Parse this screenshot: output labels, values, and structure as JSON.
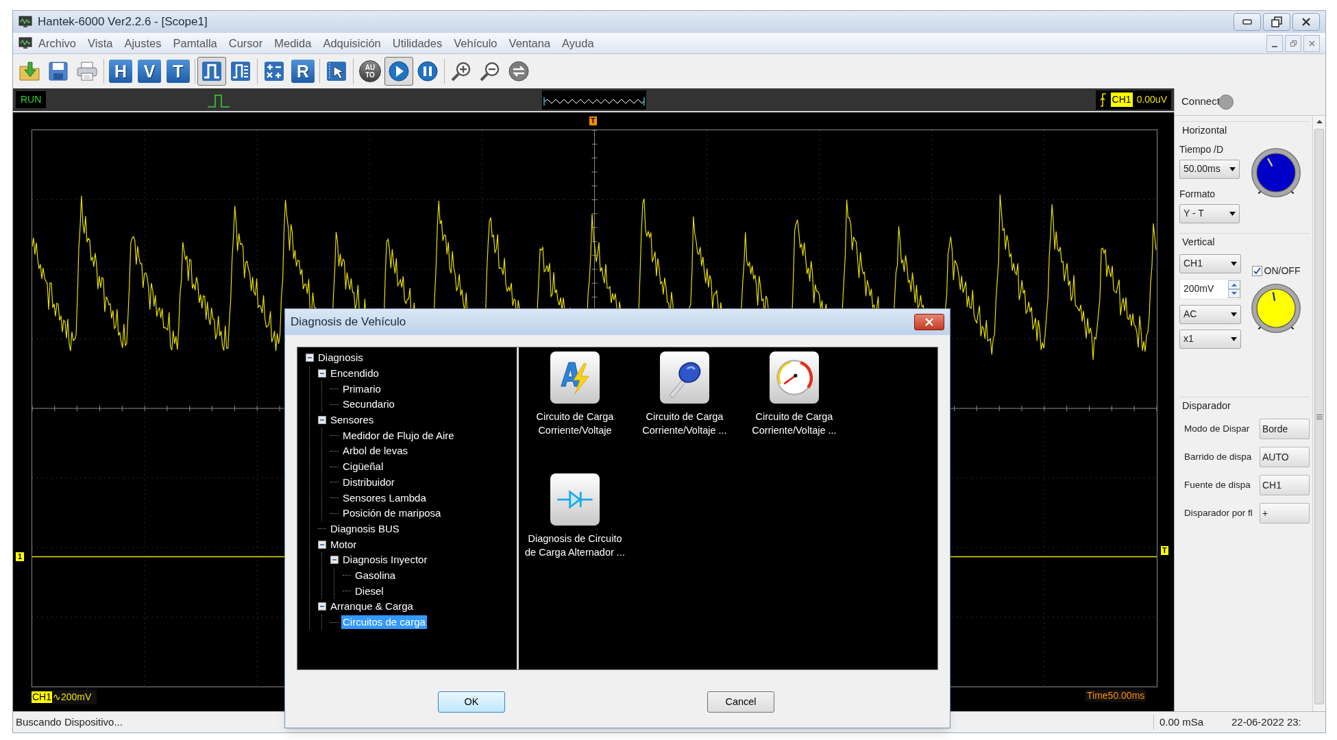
{
  "window": {
    "title": "Hantek-6000 Ver2.2.6 - [Scope1]"
  },
  "menu": [
    "Archivo",
    "Vista",
    "Ajustes",
    "Pamtalla",
    "Cursor",
    "Medida",
    "Adquisición",
    "Utilidades",
    "Vehículo",
    "Ventana",
    "Ayuda"
  ],
  "toolbar": [
    [
      {
        "kind": "open",
        "pressed": false
      },
      {
        "kind": "save",
        "pressed": false
      },
      {
        "kind": "print",
        "pressed": false
      }
    ],
    [
      {
        "kind": "letter",
        "glyph": "H",
        "pressed": false
      },
      {
        "kind": "letter",
        "glyph": "V",
        "pressed": false
      },
      {
        "kind": "letter",
        "glyph": "T",
        "pressed": false
      }
    ],
    [
      {
        "kind": "pulse",
        "pressed": true
      },
      {
        "kind": "pulse-list",
        "pressed": false
      }
    ],
    [
      {
        "kind": "math",
        "pressed": false
      },
      {
        "kind": "letter",
        "glyph": "R",
        "pressed": false
      }
    ],
    [
      {
        "kind": "cursor",
        "pressed": false
      }
    ],
    [
      {
        "kind": "auto",
        "glyph": "AU TO",
        "pressed": false
      },
      {
        "kind": "play",
        "pressed": true
      },
      {
        "kind": "pause",
        "pressed": false
      }
    ],
    [
      {
        "kind": "zoom-in",
        "pressed": false
      },
      {
        "kind": "zoom-out",
        "pressed": false
      },
      {
        "kind": "swap",
        "pressed": false
      }
    ]
  ],
  "scope": {
    "run_label": "RUN",
    "trigger": {
      "channel": "CH1",
      "value": "0.00uV"
    },
    "top_marker": "T",
    "right_marker": "T",
    "channel_marker": "1",
    "channel_label": "CH1",
    "scale": "∿200mV",
    "time": "Time50.00ms"
  },
  "control_panel": {
    "connect_label": "Connect",
    "connected": false,
    "horizontal": {
      "title": "Horizontal",
      "time_label": "Tiempo /D",
      "time_value": "50.00ms",
      "format_label": "Formato",
      "format_value": "Y - T"
    },
    "vertical": {
      "title": "Vertical",
      "channel": "CH1",
      "enabled_label": "ON/OFF",
      "enabled": true,
      "volts": "200mV",
      "coupling": "AC",
      "probe": "x1"
    },
    "trigger": {
      "title": "Disparador",
      "rows": [
        {
          "label": "Modo de Dispar",
          "value": "Borde"
        },
        {
          "label": "Barrido de dispa",
          "value": "AUTO"
        },
        {
          "label": "Fuente de dispa",
          "value": "CH1"
        },
        {
          "label": "Disparador por fl",
          "value": "+"
        }
      ]
    }
  },
  "dialog": {
    "title": "Diagnosis de Vehículo",
    "tree": [
      {
        "label": "Diagnosis",
        "expanded": true,
        "selected": false,
        "children": [
          {
            "label": "Encendido",
            "expanded": true,
            "selected": false,
            "children": [
              {
                "label": "Primario",
                "selected": false
              },
              {
                "label": "Secundario",
                "selected": false
              }
            ]
          },
          {
            "label": "Sensores",
            "expanded": true,
            "selected": false,
            "children": [
              {
                "label": "Medidor de Flujo de Aire",
                "selected": false
              },
              {
                "label": "Arbol de levas",
                "selected": false
              },
              {
                "label": "Cigüeñal",
                "selected": false
              },
              {
                "label": "Distribuidor",
                "selected": false
              },
              {
                "label": "Sensores Lambda",
                "selected": false
              },
              {
                "label": "Posición de mariposa",
                "selected": false
              }
            ]
          },
          {
            "label": "Diagnosis BUS",
            "selected": false
          },
          {
            "label": "Motor",
            "expanded": true,
            "selected": false,
            "children": [
              {
                "label": "Diagnosis Inyector",
                "expanded": true,
                "selected": false,
                "children": [
                  {
                    "label": "Gasolina",
                    "selected": false
                  },
                  {
                    "label": "Diesel",
                    "selected": false
                  }
                ]
              }
            ]
          },
          {
            "label": "Arranque & Carga",
            "expanded": true,
            "selected": false,
            "children": [
              {
                "label": "Circuitos de carga",
                "selected": true
              }
            ]
          }
        ]
      }
    ],
    "tests": [
      {
        "kind": "lightning",
        "lines": [
          "Circuito de Carga",
          "Corriente/Voltaje"
        ]
      },
      {
        "kind": "key",
        "lines": [
          "Circuito de Carga",
          "Corriente/Voltaje ..."
        ]
      },
      {
        "kind": "gauge",
        "lines": [
          "Circuito de Carga",
          "Corriente/Voltaje ..."
        ]
      },
      {
        "kind": "diode",
        "lines": [
          "Diagnosis de Circuito",
          "de Carga Alternador ..."
        ]
      }
    ],
    "buttons": [
      "OK",
      "Cancel"
    ]
  },
  "status_bar": {
    "message": "Buscando Dispositivo...",
    "sample_rate": "0.00 mSa",
    "datetime": "22-06-2022 23:"
  }
}
